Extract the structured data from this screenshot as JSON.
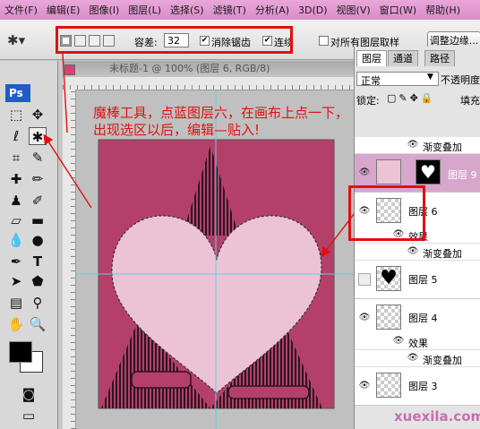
{
  "menubar": {
    "items": [
      "文件(F)",
      "编辑(E)",
      "图像(I)",
      "图层(L)",
      "选择(S)",
      "滤镜(T)",
      "分析(A)",
      "3D(D)",
      "视图(V)",
      "窗口(W)",
      "帮助(H)"
    ]
  },
  "options": {
    "tolerance_label": "容差:",
    "tolerance_value": "32",
    "antialias_label": "消除锯齿",
    "antialias_checked": true,
    "contiguous_label": "连续",
    "contiguous_checked": true,
    "sample_all_label": "对所有图层取样",
    "sample_all_checked": false,
    "refine_edge_label": "调整边缘..."
  },
  "toolbox": {
    "logo": "Ps"
  },
  "document": {
    "title": "未标题-1 @ 100% (图层 6, RGB/8)"
  },
  "annotation": {
    "text": "魔棒工具，点蓝图层六，在画布上点一下，出现选区以后，编辑—贴入!",
    "color": "#e01010"
  },
  "layers_panel": {
    "tabs": [
      "图层",
      "通道",
      "路径"
    ],
    "blend_mode": "正常",
    "opacity_label": "不透明度",
    "lock_label": "锁定:",
    "fill_label": "填充",
    "layers": [
      {
        "kind": "effect",
        "label": "渐变叠加"
      },
      {
        "kind": "layer",
        "name": "图层 9",
        "visible": true,
        "selected": true
      },
      {
        "kind": "layer",
        "name": "图层 6",
        "visible": true,
        "selected": false
      },
      {
        "kind": "effect-header",
        "label": "效果"
      },
      {
        "kind": "effect",
        "label": "渐变叠加"
      },
      {
        "kind": "layer",
        "name": "图层 5",
        "visible": false,
        "selected": false
      },
      {
        "kind": "layer",
        "name": "图层 4",
        "visible": true,
        "selected": false
      },
      {
        "kind": "effect-header",
        "label": "效果"
      },
      {
        "kind": "effect",
        "label": "渐变叠加"
      },
      {
        "kind": "layer",
        "name": "图层 3",
        "visible": true,
        "selected": false
      }
    ]
  },
  "watermark": "xuexila.com",
  "colors": {
    "canvas_bg": "#b4406a",
    "heart": "#ecc3d5",
    "triangle_stripe": "#2a1520",
    "annotation_box": "#e01010",
    "guide": "#5ad0e8"
  }
}
